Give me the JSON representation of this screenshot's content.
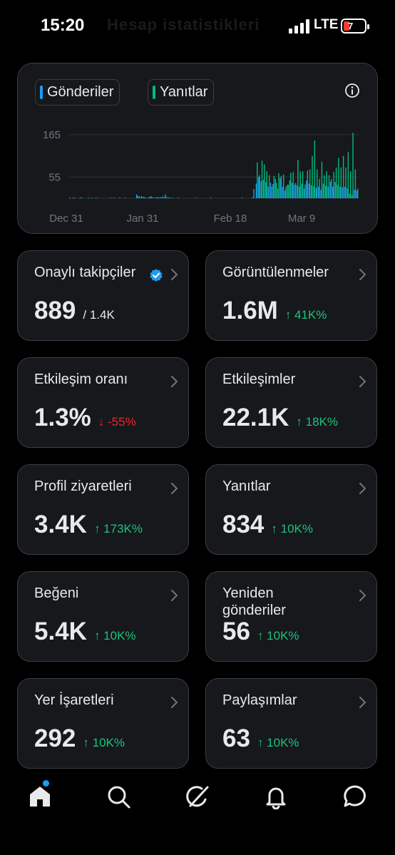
{
  "status_bar": {
    "time": "15:20",
    "network": "LTE",
    "battery": "7",
    "background_title": "Hesap istatistikleri"
  },
  "chart": {
    "legend": [
      {
        "label": "Gönderiler",
        "color": "#1d9bf0"
      },
      {
        "label": "Yanıtlar",
        "color": "#00ba7c"
      }
    ],
    "y_ticks": [
      "165",
      "55"
    ],
    "x_ticks": [
      "Dec 31",
      "Jan 31",
      "Feb 18",
      "Mar 9"
    ],
    "info_icon": "info-circle-icon"
  },
  "chart_data": {
    "type": "bar",
    "y_ticks": [
      55,
      165
    ],
    "x_tick_labels": [
      "Dec 31",
      "Jan 31",
      "Feb 18",
      "Mar 9"
    ],
    "series": [
      {
        "name": "Gönderiler",
        "color": "#1d9bf0",
        "values": [
          1,
          0,
          1,
          0,
          0,
          1,
          0,
          0,
          1,
          0,
          0,
          1,
          0,
          0,
          0,
          0,
          0,
          1,
          0,
          0,
          0,
          1,
          0,
          1,
          0,
          0,
          0,
          0,
          10,
          5,
          6,
          4,
          1,
          2,
          5,
          3,
          1,
          1,
          3,
          5,
          10,
          2,
          1,
          1,
          0,
          0,
          0,
          0,
          0,
          0,
          0,
          0,
          0,
          1,
          0,
          0,
          0,
          0,
          0,
          1,
          0,
          0,
          0,
          0,
          0,
          0,
          0,
          0,
          0,
          0,
          0,
          0,
          1,
          0,
          0,
          0,
          0,
          24,
          38,
          55,
          44,
          48,
          42,
          30,
          40,
          37,
          50,
          25,
          52,
          30,
          20,
          35,
          46,
          40,
          35,
          34,
          30,
          38,
          25,
          46,
          38,
          34,
          31,
          26,
          30,
          22,
          38,
          33,
          30,
          43,
          30,
          42,
          35,
          30,
          28,
          30,
          26,
          12,
          8,
          22,
          20
        ]
      },
      {
        "name": "Yanıtlar",
        "color": "#00ba7c",
        "values": [
          0,
          1,
          0,
          0,
          1,
          0,
          0,
          0,
          0,
          1,
          0,
          0,
          0,
          0,
          0,
          0,
          0,
          0,
          1,
          0,
          0,
          0,
          0,
          0,
          0,
          0,
          0,
          0,
          6,
          2,
          3,
          1,
          0,
          4,
          2,
          0,
          3,
          2,
          1,
          2,
          3,
          1,
          0,
          0,
          0,
          1,
          0,
          0,
          0,
          0,
          0,
          0,
          0,
          0,
          0,
          0,
          0,
          0,
          0,
          0,
          0,
          0,
          0,
          0,
          0,
          0,
          0,
          0,
          0,
          0,
          0,
          0,
          0,
          0,
          0,
          0,
          2,
          0,
          93,
          60,
          98,
          88,
          70,
          60,
          30,
          58,
          40,
          65,
          58,
          62,
          30,
          35,
          66,
          68,
          40,
          100,
          70,
          70,
          36,
          72,
          75,
          110,
          150,
          75,
          50,
          95,
          60,
          70,
          60,
          50,
          68,
          80,
          105,
          80,
          110,
          80,
          120,
          70,
          170,
          75,
          25
        ]
      }
    ]
  },
  "stats": [
    {
      "label": "Onaylı takipçiler",
      "value": "889",
      "sub": "/ 1.4K",
      "change": "",
      "direction": "",
      "verified": true
    },
    {
      "label": "Görüntülenmeler",
      "value": "1.6M",
      "sub": "",
      "change": "↑ 41K%",
      "direction": "up"
    },
    {
      "label": "Etkileşim oranı",
      "value": "1.3%",
      "sub": "",
      "change": "↓ -55%",
      "direction": "down"
    },
    {
      "label": "Etkileşimler",
      "value": "22.1K",
      "sub": "",
      "change": "↑ 18K%",
      "direction": "up"
    },
    {
      "label": "Profil ziyaretleri",
      "value": "3.4K",
      "sub": "",
      "change": "↑ 173K%",
      "direction": "up"
    },
    {
      "label": "Yanıtlar",
      "value": "834",
      "sub": "",
      "change": "↑ 10K%",
      "direction": "up"
    },
    {
      "label": "Beğeni",
      "value": "5.4K",
      "sub": "",
      "change": "↑ 10K%",
      "direction": "up"
    },
    {
      "label": "Yeniden gönderiler",
      "value": "56",
      "sub": "",
      "change": "↑ 10K%",
      "direction": "up"
    },
    {
      "label": "Yer İşaretleri",
      "value": "292",
      "sub": "",
      "change": "↑ 10K%",
      "direction": "up"
    },
    {
      "label": "Paylaşımlar",
      "value": "63",
      "sub": "",
      "change": "↑ 10K%",
      "direction": "up"
    }
  ],
  "nav": [
    {
      "name": "home-icon",
      "active": true
    },
    {
      "name": "search-icon"
    },
    {
      "name": "grok-icon"
    },
    {
      "name": "notifications-bell-icon"
    },
    {
      "name": "messages-icon"
    }
  ],
  "colors": {
    "up": "#1ec37a",
    "down": "#f4212e",
    "accent": "#1d9bf0"
  }
}
